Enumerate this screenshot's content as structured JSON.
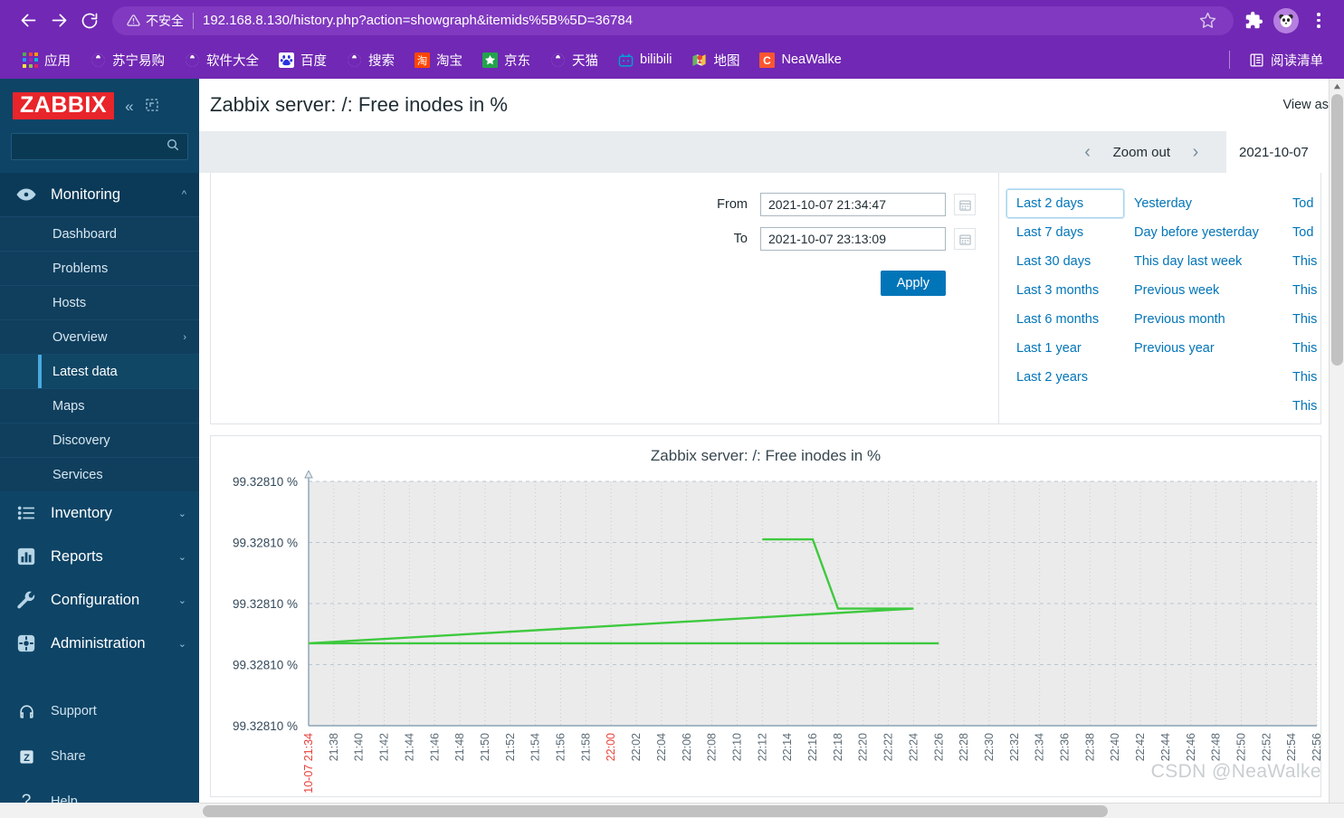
{
  "browser": {
    "back_icon": "back-arrow-icon",
    "forward_icon": "forward-arrow-icon",
    "reload_icon": "reload-icon",
    "security_label": "不安全",
    "url": "192.168.8.130/history.php?action=showgraph&itemids%5B%5D=36784",
    "star_icon": "star-icon",
    "extensions_icon": "puzzle-extensions-icon",
    "avatar_icon": "panda-avatar-icon",
    "menu_icon": "three-dot-menu-icon",
    "chrome_purple": "#7128b4",
    "omnibox_purple": "#8039c0"
  },
  "bookmarks": {
    "items": [
      {
        "label": "应用",
        "icon": "apps-grid-icon"
      },
      {
        "label": "苏宁易购",
        "icon": "globe-icon"
      },
      {
        "label": "软件大全",
        "icon": "globe-icon"
      },
      {
        "label": "百度",
        "icon": "baidu-icon"
      },
      {
        "label": "搜索",
        "icon": "globe-icon"
      },
      {
        "label": "淘宝",
        "icon": "taobao-icon"
      },
      {
        "label": "京东",
        "icon": "jd-icon"
      },
      {
        "label": "天猫",
        "icon": "globe-icon"
      },
      {
        "label": "bilibili",
        "icon": "bilibili-icon"
      },
      {
        "label": "地图",
        "icon": "map-pin-icon"
      },
      {
        "label": "NeaWalke",
        "icon": "csdn-c-icon"
      }
    ],
    "reading_list": {
      "label": "阅读清单",
      "icon": "reading-list-icon"
    }
  },
  "sidebar": {
    "logo": "ZABBIX",
    "collapse_icon": "double-chevron-left-icon",
    "compact_icon": "compact-view-icon",
    "search_placeholder": "",
    "search_value": "",
    "search_icon": "search-icon",
    "groups": [
      {
        "label": "Monitoring",
        "icon": "eye-icon",
        "expanded": true,
        "items": [
          {
            "label": "Dashboard",
            "selected": false,
            "has_sub": false
          },
          {
            "label": "Problems",
            "selected": false,
            "has_sub": false
          },
          {
            "label": "Hosts",
            "selected": false,
            "has_sub": false
          },
          {
            "label": "Overview",
            "selected": false,
            "has_sub": true
          },
          {
            "label": "Latest data",
            "selected": true,
            "has_sub": false
          },
          {
            "label": "Maps",
            "selected": false,
            "has_sub": false
          },
          {
            "label": "Discovery",
            "selected": false,
            "has_sub": false
          },
          {
            "label": "Services",
            "selected": false,
            "has_sub": false
          }
        ]
      },
      {
        "label": "Inventory",
        "icon": "list-icon",
        "expanded": false,
        "items": []
      },
      {
        "label": "Reports",
        "icon": "bar-chart-icon",
        "expanded": false,
        "items": []
      },
      {
        "label": "Configuration",
        "icon": "wrench-icon",
        "expanded": false,
        "items": []
      },
      {
        "label": "Administration",
        "icon": "gear-icon",
        "expanded": false,
        "items": []
      }
    ],
    "footer": [
      {
        "label": "Support",
        "icon": "headset-icon"
      },
      {
        "label": "Share",
        "icon": "zabbix-z-icon"
      },
      {
        "label": "Help",
        "icon": "question-mark-icon"
      }
    ]
  },
  "header": {
    "title": "Zabbix server: /: Free inodes in %",
    "view_as": "View as"
  },
  "timebar": {
    "prev_icon": "chevron-left-icon",
    "zoom_out": "Zoom out",
    "next_icon": "chevron-right-icon",
    "active_tab": "2021-10-07"
  },
  "filter": {
    "from_label": "From",
    "from_value": "2021-10-07 21:34:47",
    "to_label": "To",
    "to_value": "2021-10-07 23:13:09",
    "calendar_icon": "calendar-icon",
    "apply_label": "Apply",
    "columns": [
      {
        "links": [
          {
            "label": "Last 2 days",
            "focused": true
          },
          {
            "label": "Last 7 days",
            "focused": false
          },
          {
            "label": "Last 30 days",
            "focused": false
          },
          {
            "label": "Last 3 months",
            "focused": false
          },
          {
            "label": "Last 6 months",
            "focused": false
          },
          {
            "label": "Last 1 year",
            "focused": false
          },
          {
            "label": "Last 2 years",
            "focused": false
          }
        ]
      },
      {
        "links": [
          {
            "label": "Yesterday",
            "focused": false
          },
          {
            "label": "Day before yesterday",
            "focused": false
          },
          {
            "label": "This day last week",
            "focused": false
          },
          {
            "label": "Previous week",
            "focused": false
          },
          {
            "label": "Previous month",
            "focused": false
          },
          {
            "label": "Previous year",
            "focused": false
          }
        ]
      },
      {
        "links": [
          {
            "label": "Tod",
            "focused": false
          },
          {
            "label": "Tod",
            "focused": false
          },
          {
            "label": "This",
            "focused": false
          },
          {
            "label": "This",
            "focused": false
          },
          {
            "label": "This",
            "focused": false
          },
          {
            "label": "This",
            "focused": false
          },
          {
            "label": "This",
            "focused": false
          },
          {
            "label": "This",
            "focused": false
          }
        ]
      }
    ]
  },
  "watermark": "CSDN @NeaWalke",
  "chart_data": {
    "type": "line",
    "title": "Zabbix server: /: Free inodes in %",
    "xlabel": "",
    "ylabel": "",
    "grid": true,
    "legend_position": "none",
    "line_color": "#3ec93e",
    "plot_bg": "#ebebeb",
    "axis_color": "#8aa3b5",
    "y_ticks": [
      "99.32810 %",
      "99.32810 %",
      "99.32810 %",
      "99.32810 %",
      "99.32810 %"
    ],
    "x_ticks": [
      {
        "label": "10-07 21:34",
        "red": true
      },
      {
        "label": "21:38",
        "red": false
      },
      {
        "label": "21:40",
        "red": false
      },
      {
        "label": "21:42",
        "red": false
      },
      {
        "label": "21:44",
        "red": false
      },
      {
        "label": "21:46",
        "red": false
      },
      {
        "label": "21:48",
        "red": false
      },
      {
        "label": "21:50",
        "red": false
      },
      {
        "label": "21:52",
        "red": false
      },
      {
        "label": "21:54",
        "red": false
      },
      {
        "label": "21:56",
        "red": false
      },
      {
        "label": "21:58",
        "red": false
      },
      {
        "label": "22:00",
        "red": true
      },
      {
        "label": "22:02",
        "red": false
      },
      {
        "label": "22:04",
        "red": false
      },
      {
        "label": "22:06",
        "red": false
      },
      {
        "label": "22:08",
        "red": false
      },
      {
        "label": "22:10",
        "red": false
      },
      {
        "label": "22:12",
        "red": false
      },
      {
        "label": "22:14",
        "red": false
      },
      {
        "label": "22:16",
        "red": false
      },
      {
        "label": "22:18",
        "red": false
      },
      {
        "label": "22:20",
        "red": false
      },
      {
        "label": "22:22",
        "red": false
      },
      {
        "label": "22:24",
        "red": false
      },
      {
        "label": "22:26",
        "red": false
      },
      {
        "label": "22:28",
        "red": false
      },
      {
        "label": "22:30",
        "red": false
      },
      {
        "label": "22:32",
        "red": false
      },
      {
        "label": "22:34",
        "red": false
      },
      {
        "label": "22:36",
        "red": false
      },
      {
        "label": "22:38",
        "red": false
      },
      {
        "label": "22:40",
        "red": false
      },
      {
        "label": "22:42",
        "red": false
      },
      {
        "label": "22:44",
        "red": false
      },
      {
        "label": "22:46",
        "red": false
      },
      {
        "label": "22:48",
        "red": false
      },
      {
        "label": "22:50",
        "red": false
      },
      {
        "label": "22:52",
        "red": false
      },
      {
        "label": "22:54",
        "red": false
      },
      {
        "label": "22:56",
        "red": false
      }
    ],
    "series": [
      {
        "name": "Free inodes in %",
        "points": [
          {
            "x": "22:12",
            "y": 99.3281
          },
          {
            "x": "22:16",
            "y": 99.3281
          },
          {
            "x": "22:18",
            "y": 99.32809
          },
          {
            "x": "22:24",
            "y": 99.32809
          },
          {
            "x": "22:25",
            "y": 99.328085
          },
          {
            "x": "22:26",
            "y": 99.328085
          }
        ]
      }
    ]
  }
}
